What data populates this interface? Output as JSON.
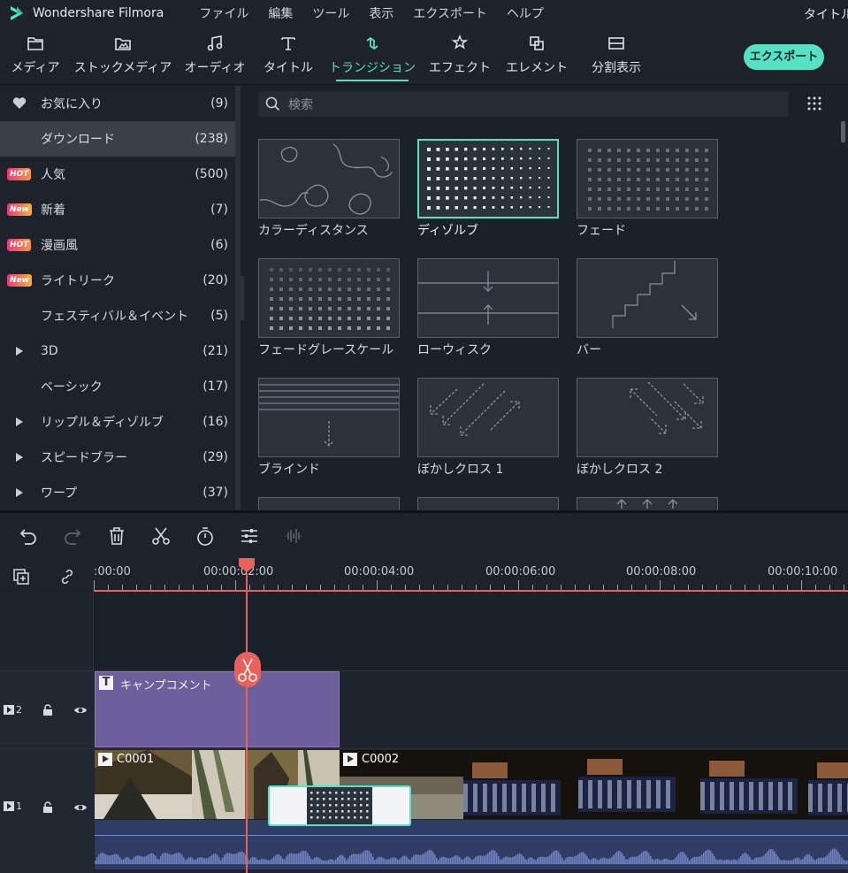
{
  "app": {
    "name": "Wondershare Filmora",
    "title_right": "タイトルな"
  },
  "menu": [
    "ファイル",
    "編集",
    "ツール",
    "表示",
    "エクスポート",
    "ヘルプ"
  ],
  "toolbar": {
    "tabs": [
      {
        "label": "メディア",
        "icon": "folder-icon"
      },
      {
        "label": "ストックメディア",
        "icon": "stock-media-icon"
      },
      {
        "label": "オーディオ",
        "icon": "music-note-icon"
      },
      {
        "label": "タイトル",
        "icon": "text-t-icon"
      },
      {
        "label": "トランジション",
        "icon": "transition-icon",
        "active": true
      },
      {
        "label": "エフェクト",
        "icon": "effect-icon"
      },
      {
        "label": "エレメント",
        "icon": "element-icon"
      },
      {
        "label": "分割表示",
        "icon": "split-screen-icon"
      }
    ],
    "export_label": "エクスポート",
    "accent": "#57e0c4"
  },
  "sidebar": {
    "items": [
      {
        "label": "お気に入り",
        "count": "(9)",
        "lead": "heart"
      },
      {
        "label": "ダウンロード",
        "count": "(238)",
        "lead": "none",
        "selected": true
      },
      {
        "label": "人気",
        "count": "(500)",
        "lead": "hot",
        "badge": "HOT"
      },
      {
        "label": "新着",
        "count": "(7)",
        "lead": "new",
        "badge": "New"
      },
      {
        "label": "漫画風",
        "count": "(6)",
        "lead": "hot",
        "badge": "HOT"
      },
      {
        "label": "ライトリーク",
        "count": "(20)",
        "lead": "new",
        "badge": "New"
      },
      {
        "label": "フェスティバル＆イベント",
        "count": "(5)",
        "lead": "none"
      },
      {
        "label": "3D",
        "count": "(21)",
        "lead": "arrow"
      },
      {
        "label": "ベーシック",
        "count": "(17)",
        "lead": "none"
      },
      {
        "label": "リップル＆ディゾルブ",
        "count": "(16)",
        "lead": "arrow"
      },
      {
        "label": "スピードブラー",
        "count": "(29)",
        "lead": "arrow"
      },
      {
        "label": "ワープ",
        "count": "(37)",
        "lead": "arrow"
      }
    ]
  },
  "search": {
    "placeholder": "検索"
  },
  "transitions": [
    {
      "label": "カラーディスタンス"
    },
    {
      "label": "ディゾルブ",
      "selected": true
    },
    {
      "label": "フェード"
    },
    {
      "label": "フェードグレースケール"
    },
    {
      "label": "ローウィスク"
    },
    {
      "label": "バー"
    },
    {
      "label": "ブラインド"
    },
    {
      "label": "ぼかしクロス 1"
    },
    {
      "label": "ぼかしクロス 2"
    }
  ],
  "timeline": {
    "ruler_labels": [
      ":00:00",
      "00:00:02:00",
      "00:00:04:00",
      "00:00:06:00",
      "00:00:08:00",
      "00:00:10:00"
    ],
    "tracks": [
      {
        "num": "2",
        "type": "title",
        "clip_label": "キャンプコメント"
      },
      {
        "num": "1",
        "type": "video",
        "clips": [
          {
            "label": "C0001"
          },
          {
            "label": "C0002"
          }
        ]
      }
    ],
    "playhead_color": "#e8615a"
  }
}
